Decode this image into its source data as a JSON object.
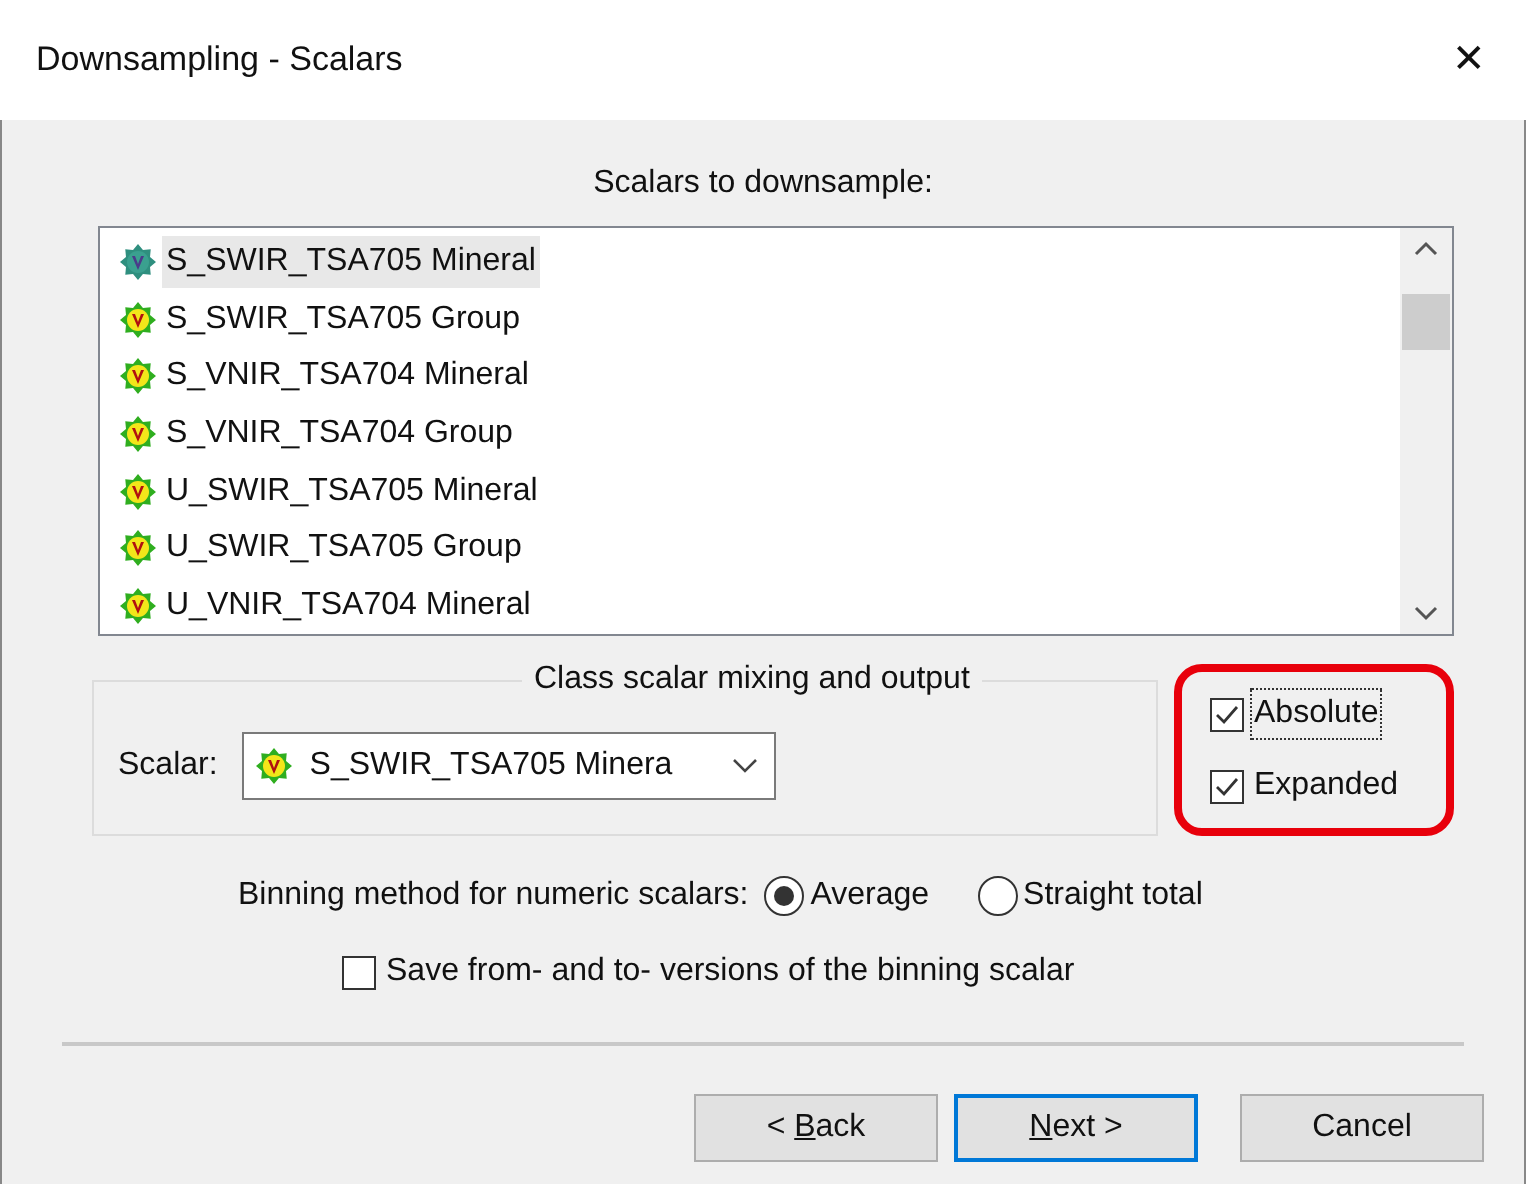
{
  "window": {
    "title": "Downsampling - Scalars",
    "close": "✕"
  },
  "scalars_list": {
    "heading": "Scalars to downsample:",
    "items": [
      {
        "label": "S_SWIR_TSA705 Mineral",
        "selected": true
      },
      {
        "label": "S_SWIR_TSA705 Group",
        "selected": false
      },
      {
        "label": "S_VNIR_TSA704 Mineral",
        "selected": false
      },
      {
        "label": "S_VNIR_TSA704 Group",
        "selected": false
      },
      {
        "label": "U_SWIR_TSA705 Mineral",
        "selected": false
      },
      {
        "label": "U_SWIR_TSA705 Group",
        "selected": false
      },
      {
        "label": "U_VNIR_TSA704 Mineral",
        "selected": false
      }
    ]
  },
  "mixing_group": {
    "heading": "Class scalar mixing and output",
    "scalar_label": "Scalar:",
    "scalar_value": "S_SWIR_TSA705 Minera",
    "checkboxes": [
      {
        "label": "Absolute",
        "checked": true,
        "focused": true
      },
      {
        "label": "Expanded",
        "checked": true,
        "focused": false
      }
    ]
  },
  "binning": {
    "label": "Binning method for numeric scalars:",
    "options": [
      {
        "label": "Average",
        "selected": true
      },
      {
        "label": "Straight total",
        "selected": false
      }
    ]
  },
  "save_versions": {
    "label": "Save from- and to- versions of the binning scalar",
    "checked": false
  },
  "buttons": [
    {
      "before": "< ",
      "mnemonic": "B",
      "after": "ack",
      "default": false
    },
    {
      "mnemonic": "N",
      "after": "ext >",
      "default": true
    },
    {
      "after": "Cancel",
      "default": false
    }
  ]
}
